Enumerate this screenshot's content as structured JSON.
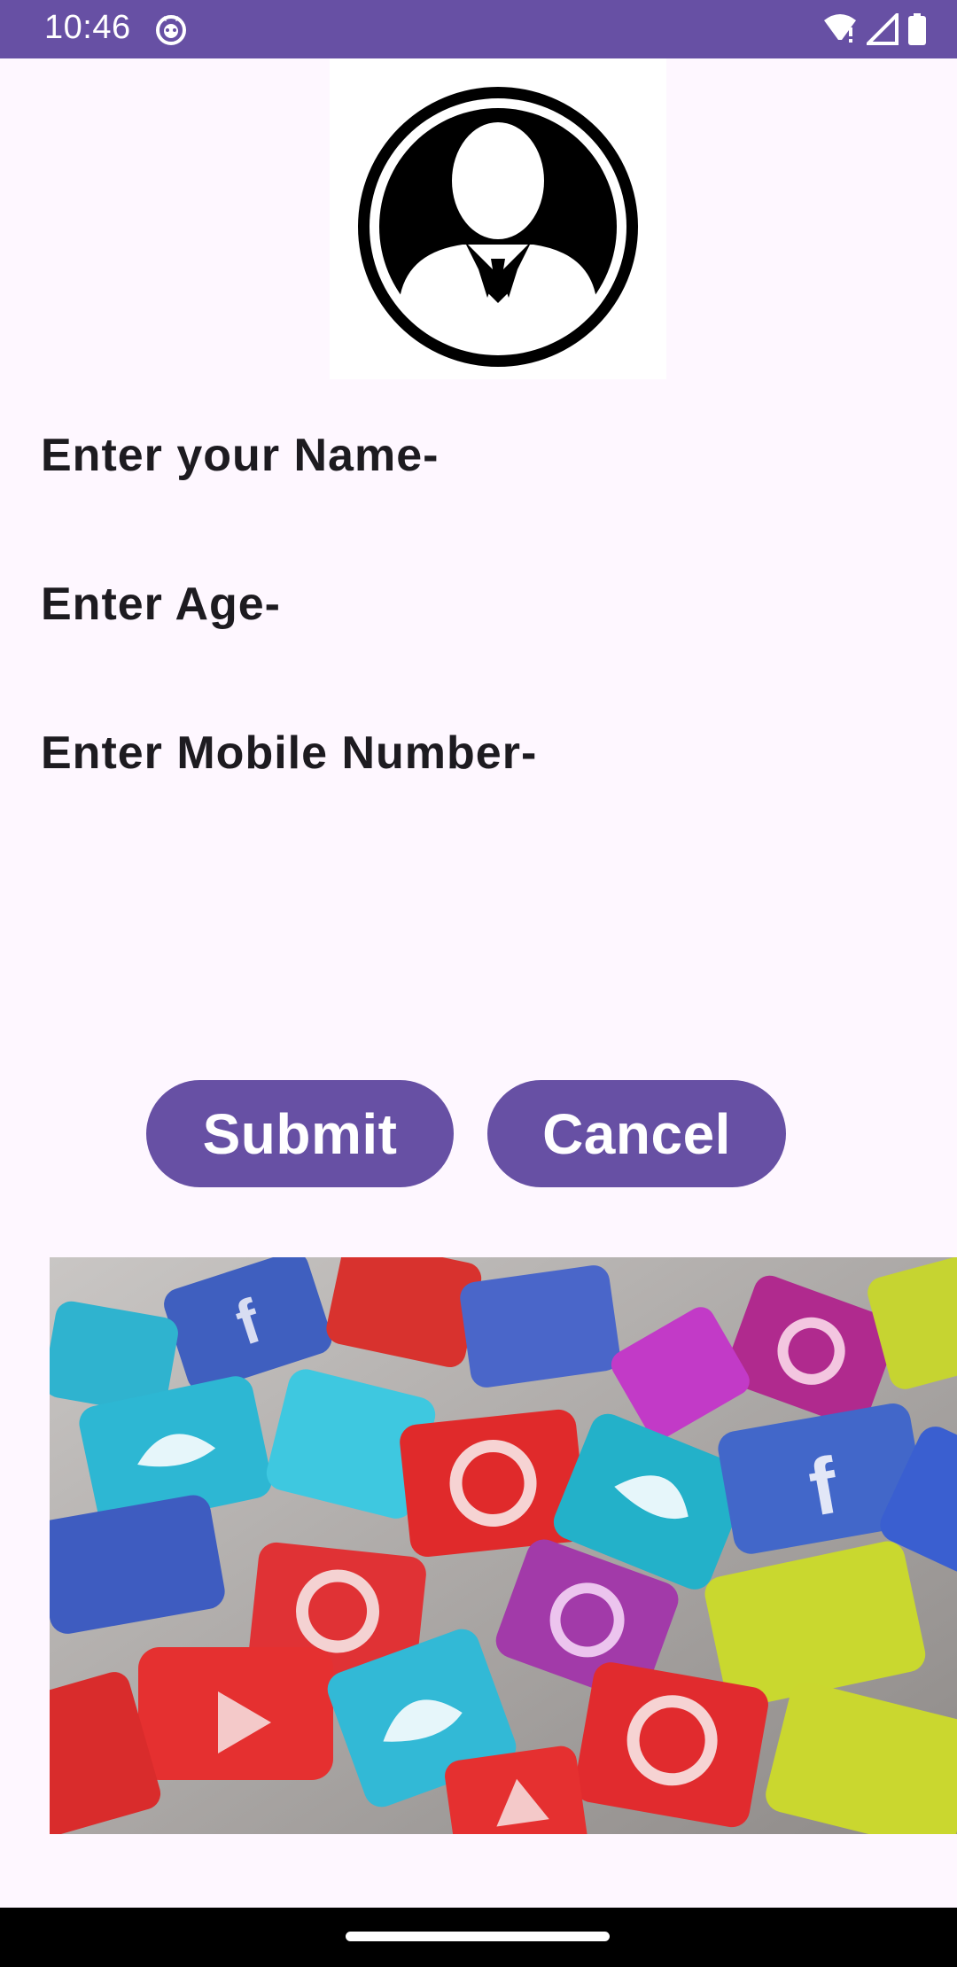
{
  "status_bar": {
    "time": "10:46",
    "background": "#6750A4",
    "icons": [
      "app-notification-icon",
      "wifi-icon",
      "signal-icon",
      "battery-icon"
    ]
  },
  "profile": {
    "avatar_icon": "user-avatar-icon"
  },
  "form": {
    "name_label": "Enter your Name-",
    "age_label": "Enter Age-",
    "mobile_label": "Enter Mobile Number-"
  },
  "actions": {
    "submit_label": "Submit",
    "cancel_label": "Cancel",
    "accent": "#6750A4"
  },
  "banner": {
    "image_subject": "social-media-icons-image"
  },
  "colors": {
    "background": "#FEF7FF",
    "text": "#1D1B20"
  }
}
